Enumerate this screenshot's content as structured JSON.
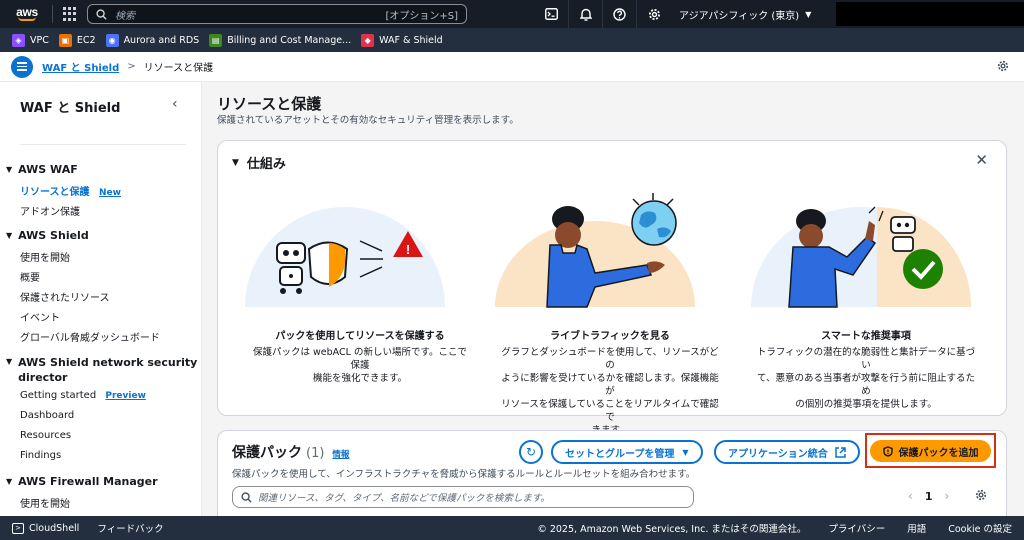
{
  "topnav": {
    "logo_text": "aws",
    "search_placeholder": "検索",
    "search_shortcut": "[オプション+S]",
    "region": "アジアパシフィック (東京)"
  },
  "favorites": [
    {
      "label": "VPC",
      "color": "#8c4fff"
    },
    {
      "label": "EC2",
      "color": "#ed7100"
    },
    {
      "label": "Aurora and RDS",
      "color": "#4d72f3"
    },
    {
      "label": "Billing and Cost Manage...",
      "color": "#3f8624"
    },
    {
      "label": "WAF & Shield",
      "color": "#dd344c"
    }
  ],
  "breadcrumb": {
    "parent": "WAF と Shield",
    "current": "リソースと保護"
  },
  "sidebar": {
    "title": "WAF と Shield",
    "sections": [
      {
        "label": "AWS WAF",
        "items": [
          {
            "label": "リソースと保護",
            "badge": "New",
            "active": true
          },
          {
            "label": "アドオン保護"
          }
        ]
      },
      {
        "label": "AWS Shield",
        "items": [
          {
            "label": "使用を開始"
          },
          {
            "label": "概要"
          },
          {
            "label": "保護されたリソース"
          },
          {
            "label": "イベント"
          },
          {
            "label": "グローバル脅威ダッシュボード"
          }
        ]
      },
      {
        "label_line1": "AWS Shield network security",
        "label_line2": "director",
        "items": [
          {
            "label": "Getting started",
            "badge": "Preview"
          },
          {
            "label": "Dashboard"
          },
          {
            "label": "Resources"
          },
          {
            "label": "Findings"
          }
        ]
      },
      {
        "label": "AWS Firewall Manager",
        "items": [
          {
            "label": "使用を開始"
          }
        ]
      }
    ]
  },
  "main": {
    "title": "リソースと保護",
    "description": "保護されているアセットとその有効なセキュリティ管理を表示します。",
    "how_it_works": {
      "heading": "仕組み",
      "cards": [
        {
          "title": "パックを使用してリソースを保護する",
          "lines": [
            "保護パックは webACL の新しい場所です。ここで保護",
            "機能を強化できます。"
          ]
        },
        {
          "title": "ライブトラフィックを見る",
          "lines": [
            "グラフとダッシュボードを使用して、リソースがどの",
            "ように影響を受けているかを確認します。保護機能が",
            "リソースを保護していることをリアルタイムで確認で",
            "きます。"
          ]
        },
        {
          "title": "スマートな推奨事項",
          "lines": [
            "トラフィックの潜在的な脆弱性と集計データに基づい",
            "て、悪意のある当事者が攻撃を行う前に阻止するため",
            "の個別の推奨事項を提供します。"
          ]
        }
      ]
    },
    "packs": {
      "title": "保護パック",
      "count": "(1)",
      "info": "情報",
      "description": "保護パックを使用して、インフラストラクチャを脅威から保護するルールとルールセットを組み合わせます。",
      "manage_button": "セットとグループを管理",
      "integration_button": "アプリケーション統合",
      "add_button": "保護パックを追加",
      "search_placeholder": "関連リソース、タグ、タイプ、名前などで保護パックを検索します。",
      "page": "1"
    }
  },
  "footer": {
    "cloudshell": "CloudShell",
    "feedback": "フィードバック",
    "copyright": "© 2025, Amazon Web Services, Inc. またはその関連会社。",
    "privacy": "プライバシー",
    "terms": "用語",
    "cookie": "Cookie の設定"
  },
  "colors": {
    "accent": "#0972d3",
    "primary": "#ff9900",
    "nav_bg": "#161d26",
    "highlight_border": "#d13212"
  }
}
